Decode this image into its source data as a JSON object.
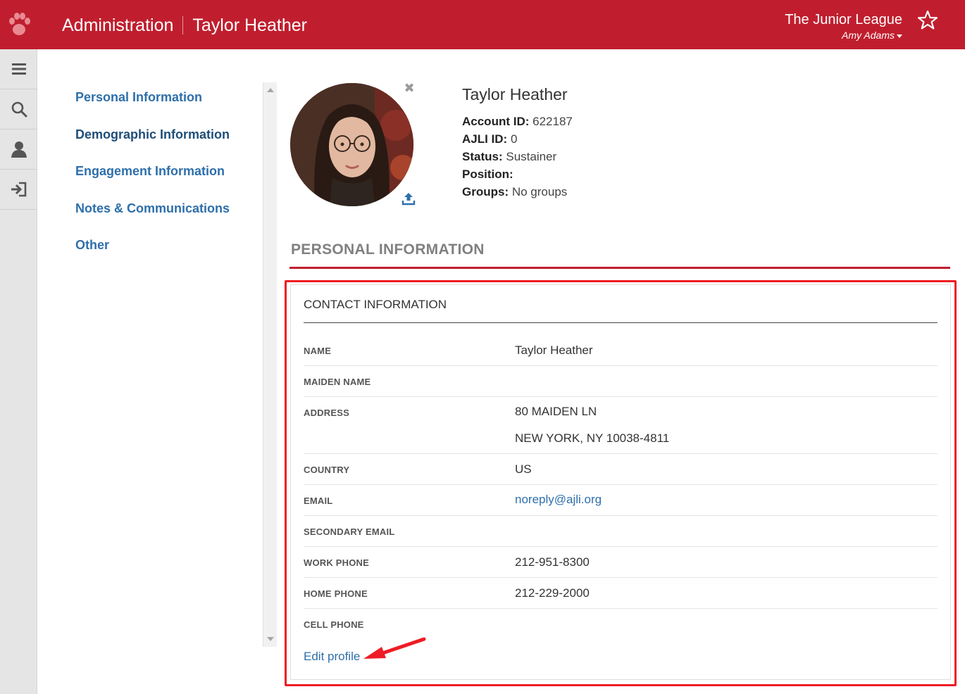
{
  "header": {
    "title": "Administration",
    "subtitle": "Taylor Heather",
    "org_name": "The Junior League",
    "user_name": "Amy Adams",
    "brand_color": "#c01e2e",
    "icons": {
      "logo": "paw-icon",
      "favorite": "star-icon"
    }
  },
  "rail": {
    "items": [
      {
        "icon": "menu-icon"
      },
      {
        "icon": "search-icon"
      },
      {
        "icon": "user-icon"
      },
      {
        "icon": "sign-in-icon"
      }
    ]
  },
  "section_nav": {
    "items": [
      {
        "label": "Personal Information",
        "active": false
      },
      {
        "label": "Demographic Information",
        "active": true
      },
      {
        "label": "Engagement Information",
        "active": false
      },
      {
        "label": "Notes & Communications",
        "active": false
      },
      {
        "label": "Other",
        "active": false
      }
    ]
  },
  "profile": {
    "name": "Taylor Heather",
    "account_id_label": "Account ID:",
    "account_id": "622187",
    "ajli_id_label": "AJLI ID:",
    "ajli_id": "0",
    "status_label": "Status:",
    "status": "Sustainer",
    "position_label": "Position:",
    "position": "",
    "groups_label": "Groups:",
    "groups": "No groups",
    "remove_photo_glyph": "✖",
    "icons": {
      "remove": "close-icon",
      "upload": "upload-icon"
    }
  },
  "personal": {
    "heading": "PERSONAL INFORMATION",
    "card_title": "CONTACT INFORMATION",
    "fields": {
      "name": {
        "label": "NAME",
        "value": "Taylor Heather"
      },
      "maiden_name": {
        "label": "MAIDEN NAME",
        "value": ""
      },
      "address": {
        "label": "ADDRESS",
        "line1": "80 MAIDEN LN",
        "line2": "NEW YORK, NY 10038-4811"
      },
      "country": {
        "label": "COUNTRY",
        "value": "US"
      },
      "email": {
        "label": "EMAIL",
        "value": "noreply@ajli.org"
      },
      "secondary_email": {
        "label": "SECONDARY EMAIL",
        "value": ""
      },
      "work_phone": {
        "label": "WORK PHONE",
        "value": "212-951-8300"
      },
      "home_phone": {
        "label": "HOME PHONE",
        "value": "212-229-2000"
      },
      "cell_phone": {
        "label": "CELL PHONE",
        "value": ""
      }
    },
    "edit_label": "Edit profile"
  },
  "annotation": {
    "color": "#ee1c24"
  }
}
